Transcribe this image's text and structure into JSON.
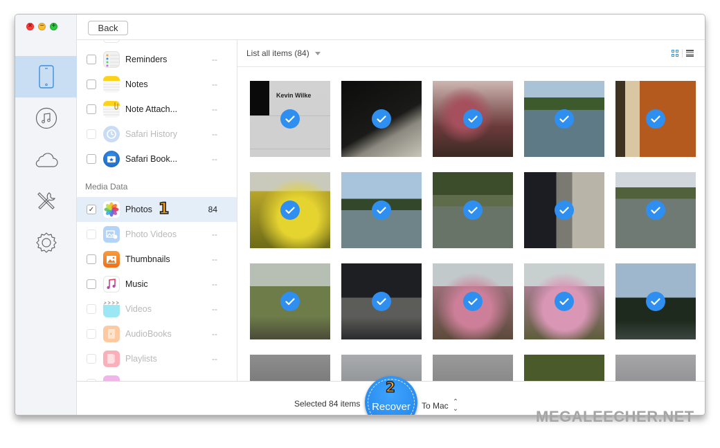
{
  "window": {
    "traffic_lights": [
      "close",
      "minimize",
      "zoom"
    ],
    "back_label": "Back"
  },
  "rail": {
    "items": [
      {
        "id": "device",
        "icon": "iphone-icon",
        "active": true
      },
      {
        "id": "itunes",
        "icon": "music-note-icon",
        "active": false
      },
      {
        "id": "icloud",
        "icon": "cloud-icon",
        "active": false
      },
      {
        "id": "tools",
        "icon": "tools-icon",
        "active": false
      },
      {
        "id": "settings",
        "icon": "gear-icon",
        "active": false
      }
    ]
  },
  "categories": {
    "items": [
      {
        "label": "Reminders",
        "count": "--",
        "checked": false,
        "disabled": false
      },
      {
        "label": "Notes",
        "count": "--",
        "checked": false,
        "disabled": false
      },
      {
        "label": "Note Attach...",
        "count": "--",
        "checked": false,
        "disabled": false
      },
      {
        "label": "Safari History",
        "count": "--",
        "checked": false,
        "disabled": true
      },
      {
        "label": "Safari Book...",
        "count": "--",
        "checked": false,
        "disabled": false
      }
    ],
    "media_section_title": "Media Data",
    "media_items": [
      {
        "label": "Photos",
        "count": "84",
        "checked": true,
        "disabled": false,
        "selected": true
      },
      {
        "label": "Photo Videos",
        "count": "--",
        "checked": false,
        "disabled": true
      },
      {
        "label": "Thumbnails",
        "count": "--",
        "checked": false,
        "disabled": false
      },
      {
        "label": "Music",
        "count": "--",
        "checked": false,
        "disabled": false
      },
      {
        "label": "Videos",
        "count": "--",
        "checked": false,
        "disabled": true
      },
      {
        "label": "AudioBooks",
        "count": "--",
        "checked": false,
        "disabled": true
      },
      {
        "label": "Playlists",
        "count": "--",
        "checked": false,
        "disabled": true
      }
    ],
    "step_badge": "1"
  },
  "content": {
    "filter_label": "List all items (84)",
    "view_modes": [
      "grid",
      "list"
    ],
    "active_view": "grid",
    "thumbnails": [
      {
        "subject": "contact screenshot",
        "caption": "Kevin Wilke",
        "checked": true
      },
      {
        "subject": "dark blurred wall",
        "checked": true
      },
      {
        "subject": "red blossom tree",
        "checked": true
      },
      {
        "subject": "lake with trees",
        "checked": true
      },
      {
        "subject": "sunset field",
        "checked": true
      },
      {
        "subject": "yellow rapeseed flowers",
        "checked": true
      },
      {
        "subject": "lake reflection",
        "checked": true
      },
      {
        "subject": "pond",
        "checked": true
      },
      {
        "subject": "desk with monitor",
        "checked": true
      },
      {
        "subject": "lake shore",
        "checked": true
      },
      {
        "subject": "willow trees",
        "checked": true
      },
      {
        "subject": "office desk",
        "checked": true
      },
      {
        "subject": "pink blossoms",
        "checked": true
      },
      {
        "subject": "pink blossom trees",
        "checked": true
      },
      {
        "subject": "dusk forest lake",
        "checked": true
      },
      {
        "subject": "frosty branches",
        "checked": false
      },
      {
        "subject": "foggy trees",
        "checked": false
      },
      {
        "subject": "frosted shrubs",
        "checked": false
      },
      {
        "subject": "orange flowers",
        "checked": false
      },
      {
        "subject": "snowy branches",
        "checked": false
      }
    ]
  },
  "bottom": {
    "selected_text": "Selected 84 items",
    "recover_label": "Recover",
    "destination": "To Mac",
    "step_badge": "2"
  },
  "watermark": "MEGALEECHER.NET",
  "colors": {
    "accent": "#2f8ff0",
    "rail_active": "#c9def3",
    "row_selected": "#e3eef9",
    "badge": "#f7a21b"
  }
}
